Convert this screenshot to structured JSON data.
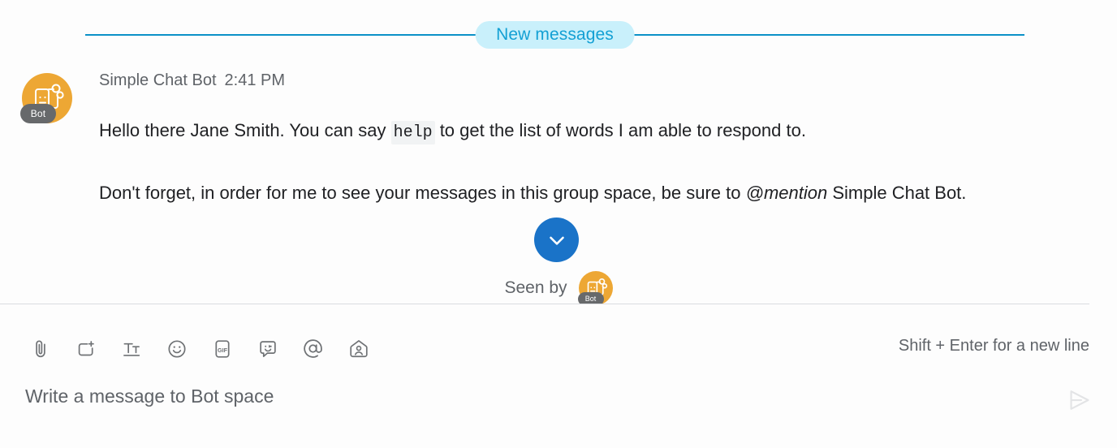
{
  "divider": {
    "label": "New messages",
    "line_color": "#0b91c7",
    "pill_bg": "#c9f0fb",
    "pill_text_color": "#13a0d4"
  },
  "message": {
    "avatar": {
      "icon": "bot-avatar-icon",
      "badge": "Bot",
      "bg_color": "#eda734",
      "badge_color": "#67696b"
    },
    "sender": "Simple Chat Bot",
    "timestamp": "2:41 PM",
    "paragraph1": {
      "before_code": "Hello there Jane Smith. You can say ",
      "code": "help",
      "after_code": " to get the list of words I am able to respond to."
    },
    "paragraph2": {
      "before_em": "Don't forget, in order for me to see your messages in this group space, be sure to ",
      "em": "@mention",
      "after_em": " Simple Chat Bot."
    }
  },
  "scroll_fab": {
    "icon": "chevron-down-icon",
    "bg_color": "#1a73c8"
  },
  "seen_by": {
    "label": "Seen by",
    "avatar_badge": "Bot"
  },
  "composer": {
    "tools": [
      {
        "name": "attach-file-icon",
        "label": "Attach file"
      },
      {
        "name": "add-card-icon",
        "label": "Add"
      },
      {
        "name": "format-text-icon",
        "label": "Format text"
      },
      {
        "name": "emoji-icon",
        "label": "Insert emoji"
      },
      {
        "name": "gif-icon",
        "label": "GIF",
        "text": "GIF"
      },
      {
        "name": "sticker-icon",
        "label": "Sticker"
      },
      {
        "name": "mention-icon",
        "label": "Mention"
      },
      {
        "name": "add-people-icon",
        "label": "Add people"
      }
    ],
    "hint": "Shift + Enter for a new line",
    "input_value": "",
    "input_placeholder": "Write a message to Bot space",
    "send_icon": "send-icon"
  }
}
